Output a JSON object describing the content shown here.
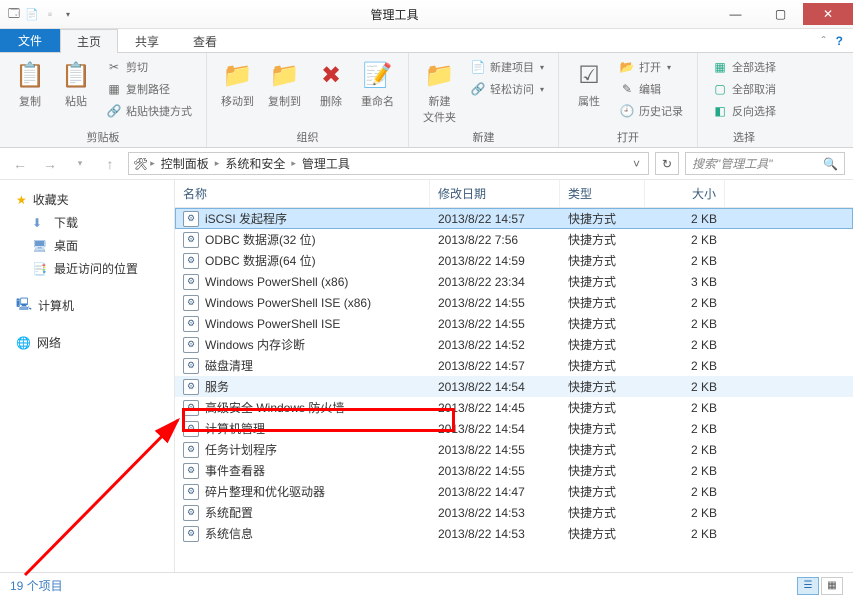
{
  "window": {
    "title": "管理工具"
  },
  "tabs": {
    "file": "文件",
    "home": "主页",
    "share": "共享",
    "view": "查看"
  },
  "ribbon": {
    "clipboard": {
      "label": "剪贴板",
      "copy": "复制",
      "paste": "粘贴",
      "cut": "剪切",
      "copypath": "复制路径",
      "pasteshortcut": "粘贴快捷方式"
    },
    "organize": {
      "label": "组织",
      "moveto": "移动到",
      "copyto": "复制到",
      "delete": "删除",
      "rename": "重命名"
    },
    "new": {
      "label": "新建",
      "newfolder": "新建\n文件夹",
      "newitem": "新建项目",
      "easyaccess": "轻松访问"
    },
    "open": {
      "label": "打开",
      "properties": "属性",
      "openbtn": "打开",
      "edit": "编辑",
      "history": "历史记录"
    },
    "select": {
      "label": "选择",
      "selectall": "全部选择",
      "selectnone": "全部取消",
      "invert": "反向选择"
    }
  },
  "breadcrumb": {
    "cp": "控制面板",
    "ss": "系统和安全",
    "at": "管理工具"
  },
  "search": {
    "placeholder": "搜索\"管理工具\""
  },
  "sidebar": {
    "fav": "收藏夹",
    "downloads": "下载",
    "desktop": "桌面",
    "recent": "最近访问的位置",
    "computer": "计算机",
    "network": "网络"
  },
  "columns": {
    "name": "名称",
    "date": "修改日期",
    "type": "类型",
    "size": "大小"
  },
  "files": [
    {
      "name": "iSCSI 发起程序",
      "date": "2013/8/22 14:57",
      "type": "快捷方式",
      "size": "2 KB",
      "sel": true
    },
    {
      "name": "ODBC 数据源(32 位)",
      "date": "2013/8/22 7:56",
      "type": "快捷方式",
      "size": "2 KB"
    },
    {
      "name": "ODBC 数据源(64 位)",
      "date": "2013/8/22 14:59",
      "type": "快捷方式",
      "size": "2 KB"
    },
    {
      "name": "Windows PowerShell (x86)",
      "date": "2013/8/22 23:34",
      "type": "快捷方式",
      "size": "3 KB"
    },
    {
      "name": "Windows PowerShell ISE (x86)",
      "date": "2013/8/22 14:55",
      "type": "快捷方式",
      "size": "2 KB"
    },
    {
      "name": "Windows PowerShell ISE",
      "date": "2013/8/22 14:55",
      "type": "快捷方式",
      "size": "2 KB"
    },
    {
      "name": "Windows 内存诊断",
      "date": "2013/8/22 14:52",
      "type": "快捷方式",
      "size": "2 KB"
    },
    {
      "name": "磁盘清理",
      "date": "2013/8/22 14:57",
      "type": "快捷方式",
      "size": "2 KB"
    },
    {
      "name": "服务",
      "date": "2013/8/22 14:54",
      "type": "快捷方式",
      "size": "2 KB",
      "hl": true
    },
    {
      "name": "高级安全 Windows 防火墙",
      "date": "2013/8/22 14:45",
      "type": "快捷方式",
      "size": "2 KB"
    },
    {
      "name": "计算机管理",
      "date": "2013/8/22 14:54",
      "type": "快捷方式",
      "size": "2 KB"
    },
    {
      "name": "任务计划程序",
      "date": "2013/8/22 14:55",
      "type": "快捷方式",
      "size": "2 KB"
    },
    {
      "name": "事件查看器",
      "date": "2013/8/22 14:55",
      "type": "快捷方式",
      "size": "2 KB"
    },
    {
      "name": "碎片整理和优化驱动器",
      "date": "2013/8/22 14:47",
      "type": "快捷方式",
      "size": "2 KB"
    },
    {
      "name": "系统配置",
      "date": "2013/8/22 14:53",
      "type": "快捷方式",
      "size": "2 KB"
    },
    {
      "name": "系统信息",
      "date": "2013/8/22 14:53",
      "type": "快捷方式",
      "size": "2 KB"
    }
  ],
  "status": {
    "count": "19 个项目"
  }
}
